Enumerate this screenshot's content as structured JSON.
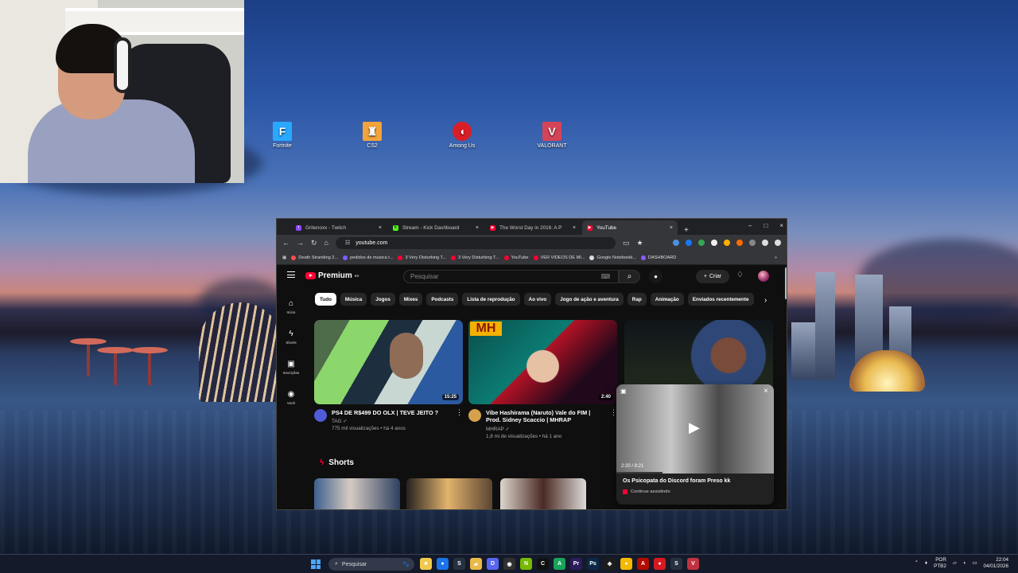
{
  "desktop": {
    "icons": [
      {
        "label": "Fortnite",
        "icon": "fortnite-icon",
        "color": "#29a8ff"
      },
      {
        "label": "CS2",
        "icon": "cs2-icon",
        "color": "#f2a33a"
      },
      {
        "label": "Among Us",
        "icon": "among-us-icon",
        "color": "#d91f26"
      },
      {
        "label": "VALORANT",
        "icon": "valorant-icon",
        "color": "#d44457"
      }
    ]
  },
  "browser": {
    "tabs": [
      {
        "label": "Gritenoxx - Twitch",
        "icon": "twitch-icon",
        "color": "#9146ff"
      },
      {
        "label": "Stream - Kick Dashboard",
        "icon": "kick-icon",
        "color": "#53fc18"
      },
      {
        "label": "The Worst Day in 2016: A P",
        "icon": "youtube-icon",
        "color": "#ff0033"
      },
      {
        "label": "YouTube",
        "icon": "youtube-icon",
        "color": "#ff0033"
      }
    ],
    "url": "youtube.com",
    "bookmarks": [
      "Death Stranding 2...",
      "pedidos de musica t...",
      "3 Very Disturbing T...",
      "3 Very Disturbing T...",
      "YouTube",
      "VER VIDEOS DE MI...",
      "Google Notebookl...",
      "DASHBOARD"
    ]
  },
  "youtube": {
    "logo": "Premium",
    "logo_region": "BR",
    "search_placeholder": "Pesquisar",
    "create_label": "Criar",
    "sidebar": [
      "Início",
      "Shorts",
      "Inscrições",
      "Você"
    ],
    "chips": [
      "Tudo",
      "Música",
      "Jogos",
      "Mixes",
      "Podcasts",
      "Lista de reprodução",
      "Ao vivo",
      "Jogo de ação e aventura",
      "Rap",
      "Animação",
      "Enviados recentemente"
    ],
    "videos": [
      {
        "title": "PS4 DE R$499 DO OLX | TEVE JEITO ?",
        "channel": "TAG",
        "stats": "775 mil visualizações • há 4 anos",
        "duration": "15:25",
        "avatar_color": "#505bd8"
      },
      {
        "title": "Vibe Hashirama (Naruto) Vale do FIM | Prod. Sidney Scaccio | MHRAP",
        "channel": "MHRAP",
        "stats": "1,8 mi de visualizações • há 1 ano",
        "duration": "2:40",
        "avatar_color": "#d5a14c"
      }
    ],
    "shorts_label": "Shorts",
    "mini_player": {
      "time": "2:20 / 8:21",
      "title": "Os Psicopata do Discord foram Preso kk",
      "status": "Continue assistindo"
    }
  },
  "taskbar": {
    "search_placeholder": "Pesquisar",
    "language": "POR",
    "layout": "PTB2",
    "time": "22:04",
    "date": "04/01/2026",
    "apps": [
      {
        "name": "file-explorer-icon",
        "color": "#f2c94c",
        "label": "■"
      },
      {
        "name": "chrome-icon",
        "color": "#1a73e8",
        "label": "●"
      },
      {
        "name": "steam-icon",
        "color": "#26313f",
        "label": "S"
      },
      {
        "name": "folder-icon",
        "color": "#e9b949",
        "label": "▰"
      },
      {
        "name": "discord-icon",
        "color": "#5865f2",
        "label": "D"
      },
      {
        "name": "obs-icon",
        "color": "#303030",
        "label": "◉"
      },
      {
        "name": "nvidia-icon",
        "color": "#76b900",
        "label": "N"
      },
      {
        "name": "capcut-icon",
        "color": "#111111",
        "label": "C"
      },
      {
        "name": "app-icon",
        "color": "#18a35a",
        "label": "A"
      },
      {
        "name": "premiere-icon",
        "color": "#2b1c5c",
        "label": "Pr"
      },
      {
        "name": "photoshop-icon",
        "color": "#0b2946",
        "label": "Ps"
      },
      {
        "name": "controller-icon",
        "color": "#1c1c1c",
        "label": "✥"
      },
      {
        "name": "chrome-canary-icon",
        "color": "#f6b900",
        "label": "●"
      },
      {
        "name": "acrobat-icon",
        "color": "#b30b00",
        "label": "A"
      },
      {
        "name": "record-icon",
        "color": "#d71920",
        "label": "●"
      },
      {
        "name": "steam-small-icon",
        "color": "#26313f",
        "label": "S"
      },
      {
        "name": "valorant-task-icon",
        "color": "#c1313f",
        "label": "V"
      }
    ]
  }
}
